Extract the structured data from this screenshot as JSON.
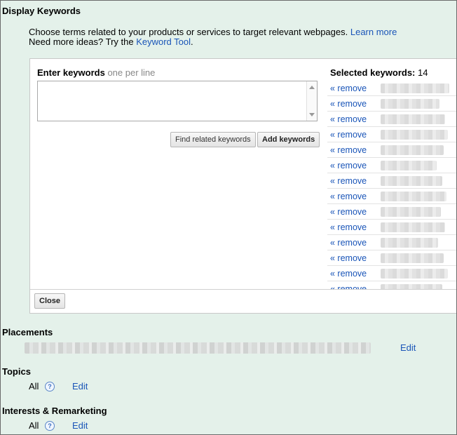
{
  "display_keywords": {
    "title": "Display Keywords",
    "intro_line1": "Choose terms related to your products or services to target relevant webpages.",
    "learn_more": "Learn more",
    "intro_line2": "Need more ideas? Try the",
    "keyword_tool": "Keyword Tool",
    "intro_line2_end": ".",
    "enter_label": "Enter keywords",
    "enter_hint": "one per line",
    "textarea_value": "",
    "find_related_button": "Find related keywords",
    "add_keywords_button": "Add keywords",
    "selected_label": "Selected keywords:",
    "selected_count": "14",
    "remove_label": "« remove",
    "close_button": "Close"
  },
  "placements": {
    "title": "Placements",
    "edit": "Edit"
  },
  "topics": {
    "title": "Topics",
    "value": "All",
    "help_icon": "?",
    "edit": "Edit"
  },
  "interests": {
    "title": "Interests & Remarketing",
    "value": "All",
    "help_icon": "?",
    "edit": "Edit"
  }
}
